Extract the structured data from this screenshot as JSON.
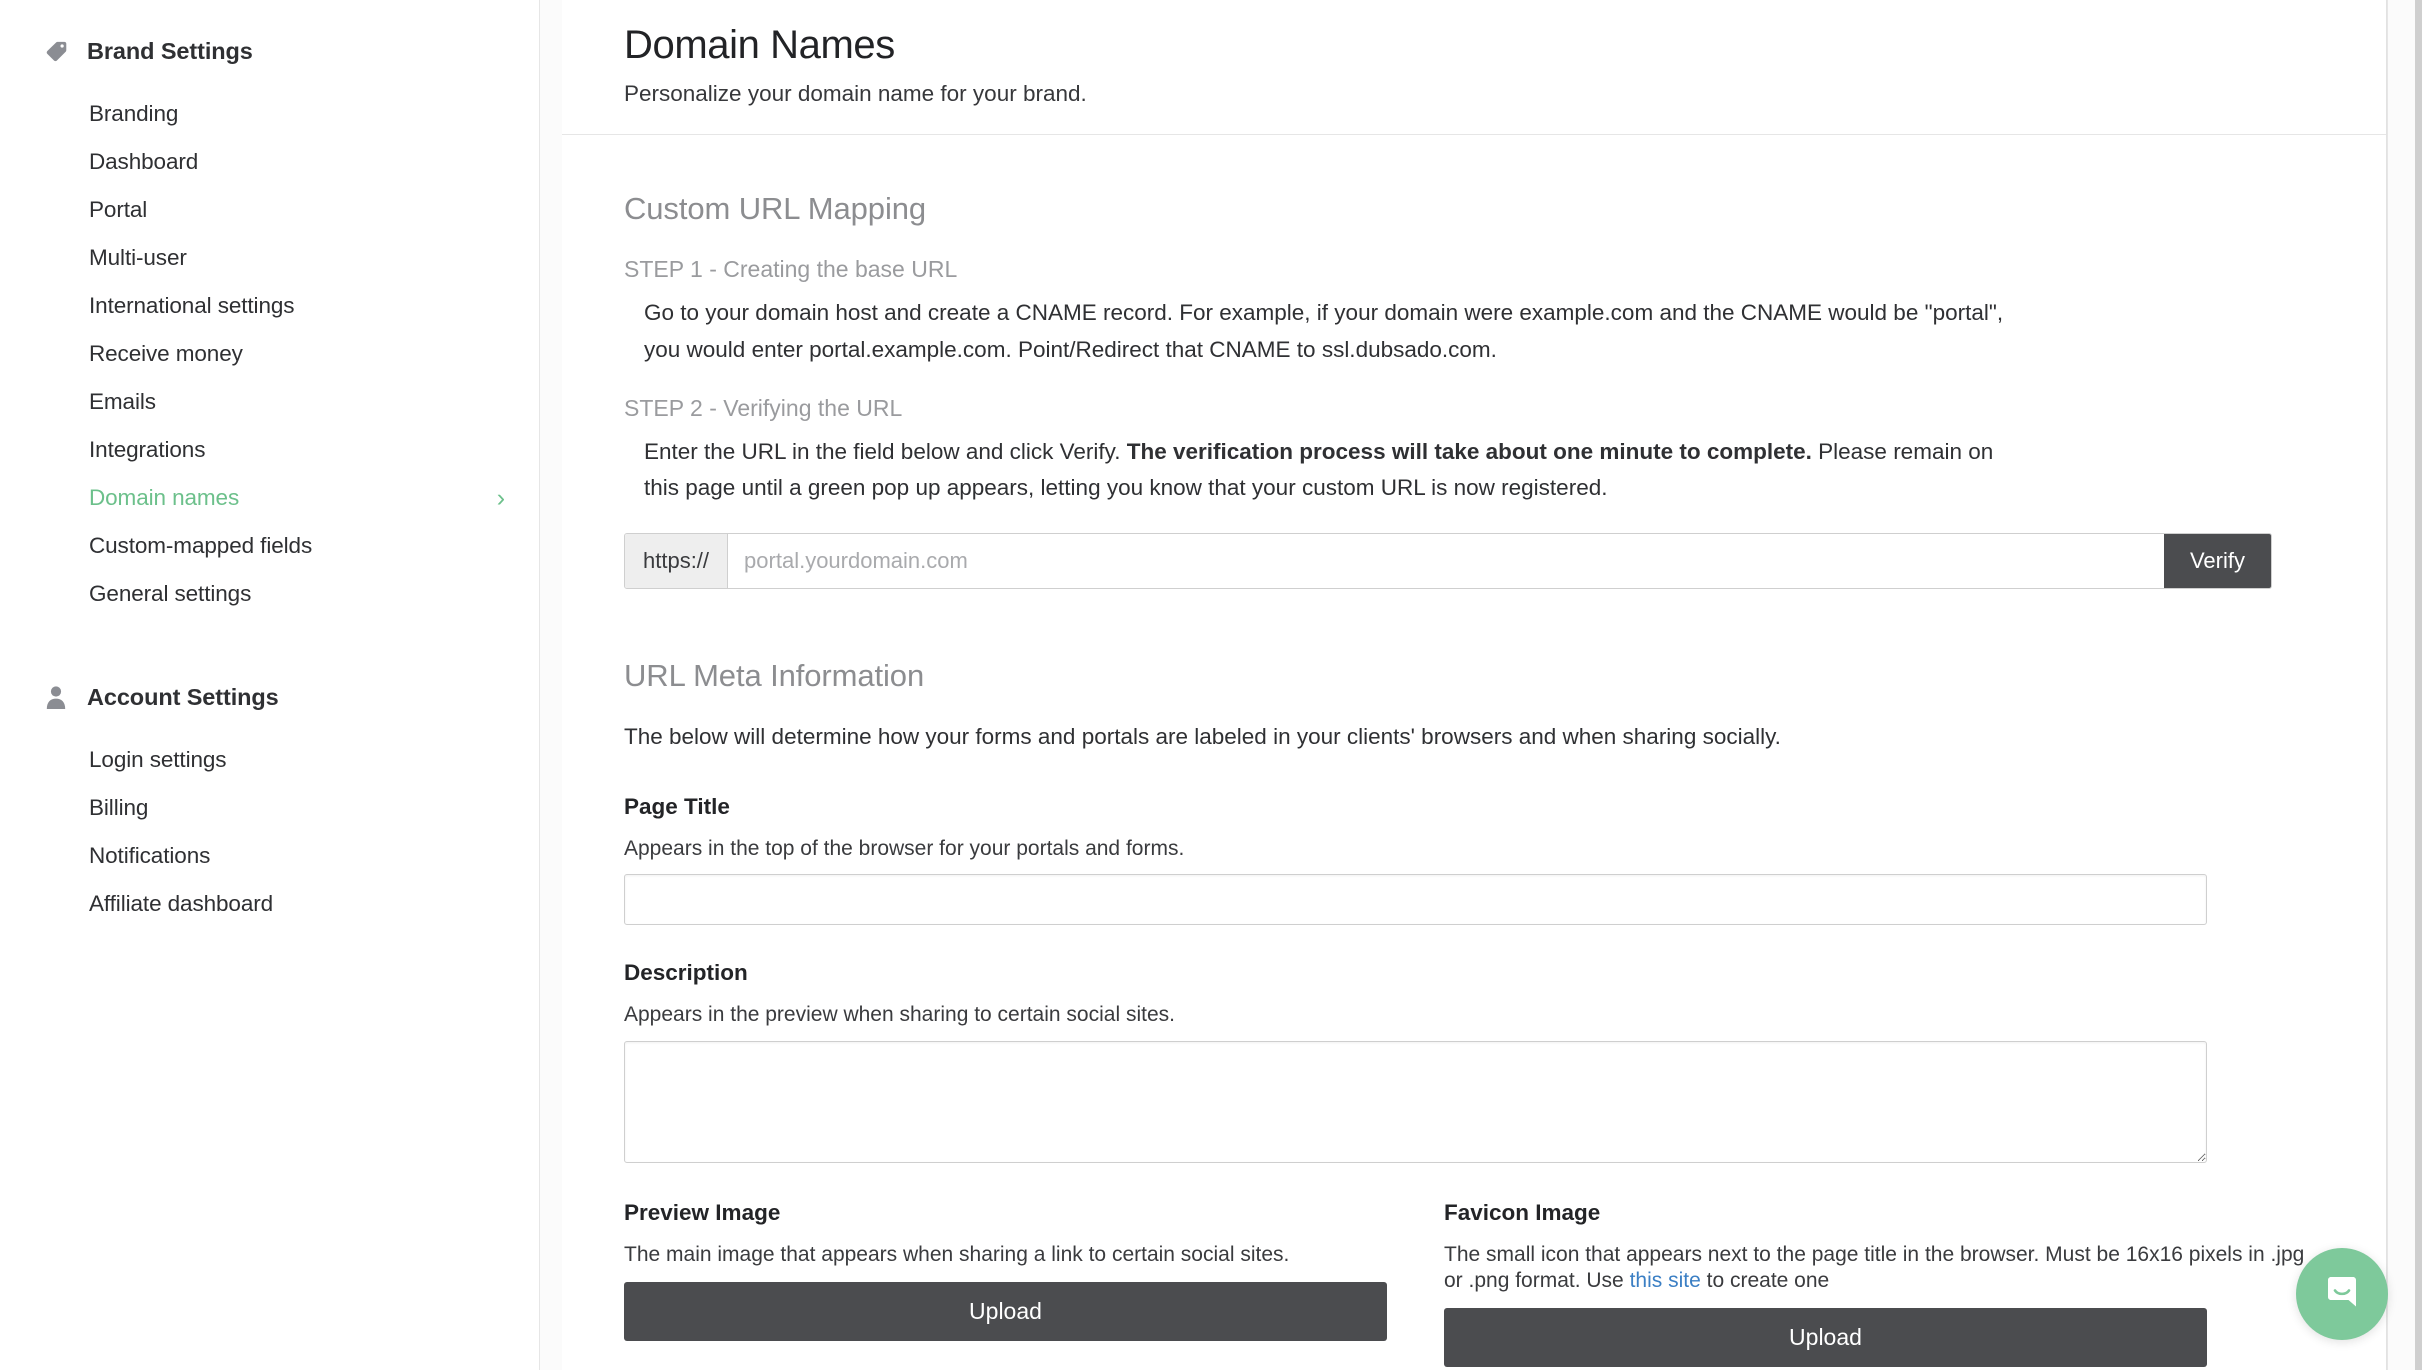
{
  "sidebar": {
    "groups": [
      {
        "label": "Brand Settings",
        "icon": "tag-icon",
        "items": [
          {
            "label": "Branding",
            "active": false
          },
          {
            "label": "Dashboard",
            "active": false
          },
          {
            "label": "Portal",
            "active": false
          },
          {
            "label": "Multi-user",
            "active": false
          },
          {
            "label": "International settings",
            "active": false
          },
          {
            "label": "Receive money",
            "active": false
          },
          {
            "label": "Emails",
            "active": false
          },
          {
            "label": "Integrations",
            "active": false
          },
          {
            "label": "Domain names",
            "active": true
          },
          {
            "label": "Custom-mapped fields",
            "active": false
          },
          {
            "label": "General settings",
            "active": false
          }
        ]
      },
      {
        "label": "Account Settings",
        "icon": "user-icon",
        "items": [
          {
            "label": "Login settings",
            "active": false
          },
          {
            "label": "Billing",
            "active": false
          },
          {
            "label": "Notifications",
            "active": false
          },
          {
            "label": "Affiliate dashboard",
            "active": false
          }
        ]
      }
    ],
    "chevron_glyph": "›",
    "active_color": "#6cc08b"
  },
  "header": {
    "title": "Domain Names",
    "subtitle": "Personalize your domain name for your brand."
  },
  "custom_url": {
    "section_title": "Custom URL Mapping",
    "step1_label": "STEP 1 - Creating the base URL",
    "step1_body": "Go to your domain host and create a CNAME record. For example, if your domain were example.com and the CNAME would be \"portal\", you would enter portal.example.com. Point/Redirect that CNAME to ssl.dubsado.com.",
    "step2_label": "STEP 2 - Verifying the URL",
    "step2_body_pre": "Enter the URL in the field below and click Verify. ",
    "step2_body_bold": "The verification process will take about one minute to complete.",
    "step2_body_post": " Please remain on this page until a green pop up appears, letting you know that your custom URL is now registered.",
    "url_prefix": "https://",
    "url_placeholder": "portal.yourdomain.com",
    "url_value": "",
    "verify_label": "Verify"
  },
  "meta": {
    "section_title": "URL Meta Information",
    "intro": "The below will determine how your forms and portals are labeled in your clients' browsers and when sharing socially.",
    "page_title": {
      "label": "Page Title",
      "help": "Appears in the top of the browser for your portals and forms.",
      "value": "",
      "placeholder": ""
    },
    "description": {
      "label": "Description",
      "help": "Appears in the preview when sharing to certain social sites.",
      "value": "",
      "placeholder": ""
    },
    "preview_image": {
      "label": "Preview Image",
      "help": "The main image that appears when sharing a link to certain social sites.",
      "upload_label": "Upload"
    },
    "favicon_image": {
      "label": "Favicon Image",
      "help_pre": "The small icon that appears next to the page title in the browser. Must be 16x16 pixels in .jpg or .png format. Use ",
      "help_link": "this site",
      "help_post": " to create one",
      "upload_label": "Upload"
    }
  },
  "chat_widget": {
    "name": "intercom-launcher",
    "color": "#7ec99b"
  },
  "colors": {
    "accent_green": "#6cc08b",
    "dark_button": "#4b4c4f",
    "link_blue": "#3b7fc4"
  }
}
